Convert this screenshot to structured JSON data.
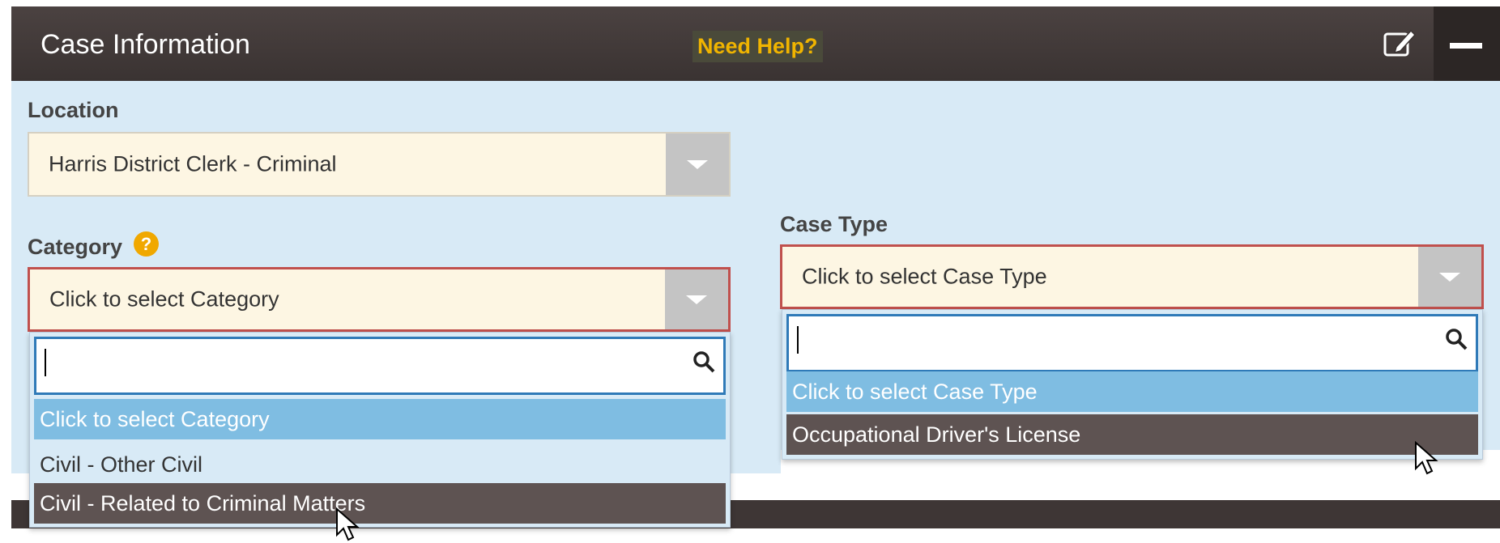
{
  "header": {
    "title": "Case Information",
    "help_label": "Need Help?",
    "edit_icon": "edit-icon",
    "collapse_icon": "minus-icon"
  },
  "location": {
    "label": "Location",
    "value": "Harris District Clerk - Criminal"
  },
  "category": {
    "label": "Category",
    "help_glyph": "?",
    "value": "Click to select Category",
    "options": [
      "Click to select Category",
      "Civil - Other Civil",
      "Civil - Related to Criminal Matters"
    ],
    "highlighted_index": 0,
    "hovered_index": 2
  },
  "case_type": {
    "label": "Case Type",
    "value": "Click to select Case Type",
    "options": [
      "Click to select Case Type",
      "Occupational Driver's License"
    ],
    "highlighted_index": 0,
    "hovered_index": 1
  },
  "colors": {
    "header_bg": "#3e3635",
    "panel_bg": "#d8eaf6",
    "select_bg": "#fdf6e3",
    "invalid_border": "#c0504d",
    "option_selected": "#7fbde2",
    "option_hover": "#5e5352",
    "help_text": "#f0b400"
  }
}
